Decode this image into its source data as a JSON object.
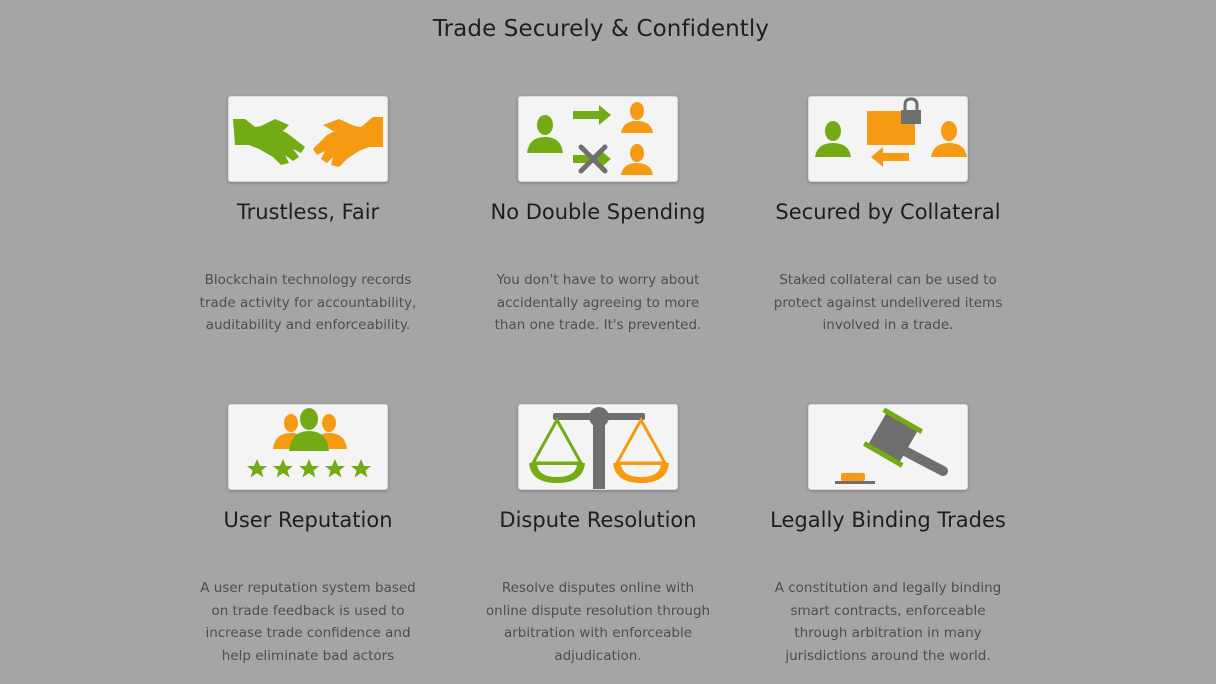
{
  "heading": "Trade Securely & Confidently",
  "colors": {
    "background": "#a5a5a5",
    "card": "#f4f4f4",
    "green": "#72ab14",
    "orange": "#f59a11",
    "gray": "#6f6f6f"
  },
  "features": [
    {
      "icon": "handshake-icon",
      "title": "Trustless, Fair",
      "description": "Blockchain technology records trade activity for accountability, auditability and enforceability."
    },
    {
      "icon": "no-double-spend-icon",
      "title": "No Double Spending",
      "description": "You don't have to worry about accidentally agreeing to more than one trade. It's prevented."
    },
    {
      "icon": "collateral-lock-icon",
      "title": "Secured by Collateral",
      "description": "Staked collateral can be used to protect against undelivered items involved in a trade."
    },
    {
      "icon": "reputation-stars-icon",
      "title": "User Reputation",
      "description": "A user reputation system based on trade feedback is used to increase trade confidence and help eliminate bad actors"
    },
    {
      "icon": "scales-icon",
      "title": "Dispute Resolution",
      "description": "Resolve disputes online with online dispute resolution through arbitration with enforceable adjudication."
    },
    {
      "icon": "gavel-icon",
      "title": "Legally Binding Trades",
      "description": "A constitution and legally binding smart contracts, enforceable through arbitration in many jurisdictions around the world."
    }
  ]
}
